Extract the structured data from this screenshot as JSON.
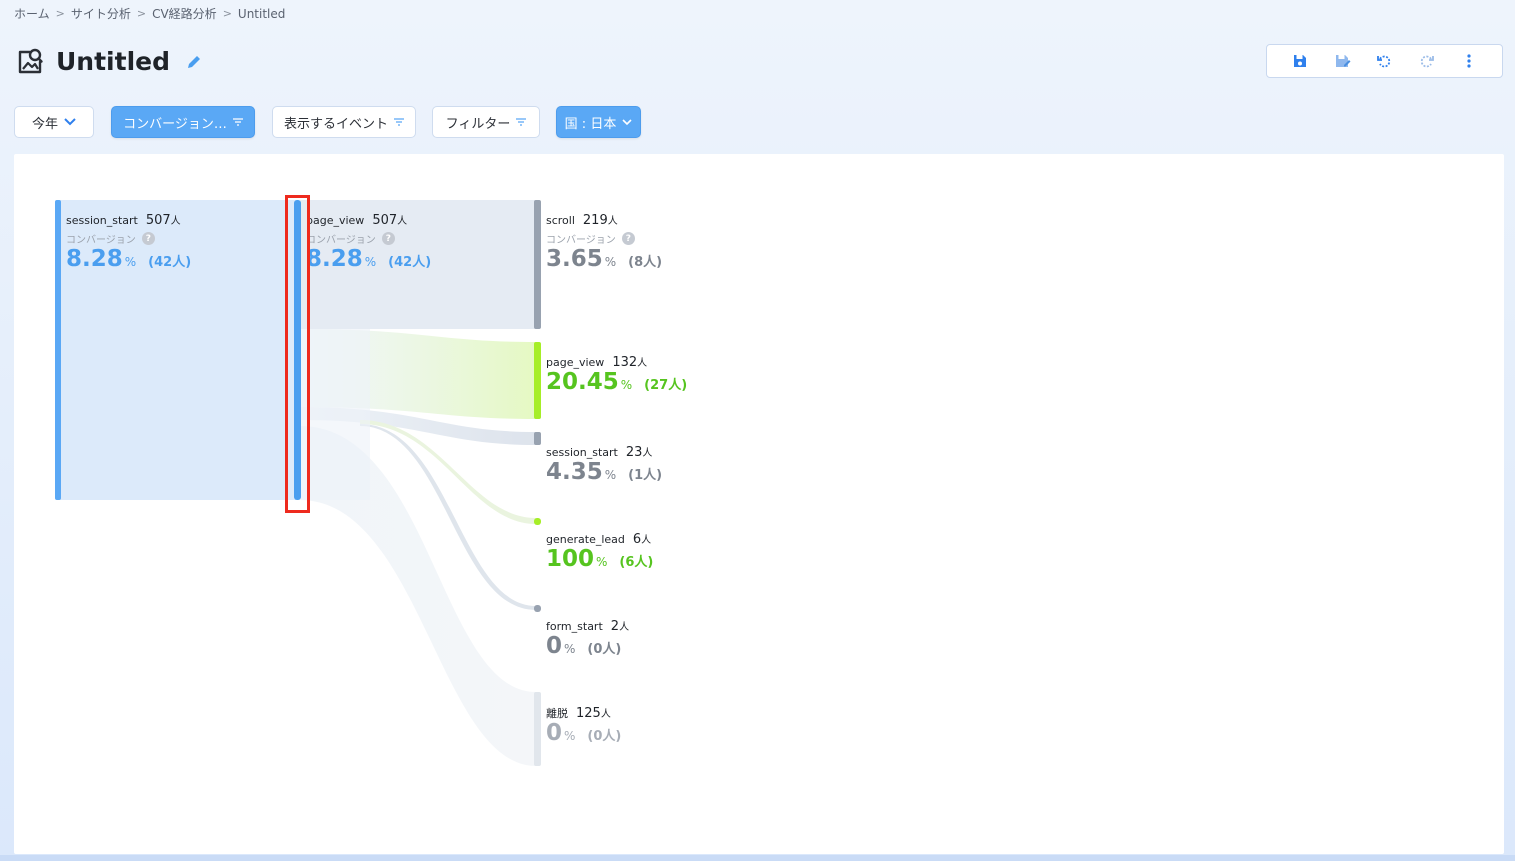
{
  "breadcrumb": [
    "ホーム",
    "サイト分析",
    "CV経路分析",
    "Untitled"
  ],
  "title": "Untitled",
  "filters": {
    "period": "今年",
    "conversion": "コンバージョン…",
    "events": "表示するイベント",
    "filter": "フィルター",
    "country": "国 : 日本"
  },
  "colors": {
    "accent_blue": "#5aa8f5",
    "green": "#56c41f",
    "lime": "#a6ee27",
    "gray": "#7d848e",
    "highlight_red": "#ee2a1e"
  },
  "nodes": {
    "level1": {
      "event": "session_start",
      "count": "507",
      "unit": "人",
      "sub": "コンバージョン",
      "pct": "8.28",
      "pct_unit": "%",
      "people": "(42人)"
    },
    "level2": {
      "event": "page_view",
      "count": "507",
      "unit": "人",
      "sub": "コンバージョン",
      "pct": "8.28",
      "pct_unit": "%",
      "people": "(42人)"
    },
    "targets": [
      {
        "event": "scroll",
        "count": "219",
        "unit": "人",
        "sub": "コンバージョン",
        "pct": "3.65",
        "pct_unit": "%",
        "people": "(8人)",
        "value": 219
      },
      {
        "event": "page_view",
        "count": "132",
        "unit": "人",
        "pct": "20.45",
        "pct_unit": "%",
        "people": "(27人)",
        "value": 132
      },
      {
        "event": "session_start",
        "count": "23",
        "unit": "人",
        "pct": "4.35",
        "pct_unit": "%",
        "people": "(1人)",
        "value": 23
      },
      {
        "event": "generate_lead",
        "count": "6",
        "unit": "人",
        "pct": "100",
        "pct_unit": "%",
        "people": "(6人)",
        "value": 6
      },
      {
        "event": "form_start",
        "count": "2",
        "unit": "人",
        "pct": "0",
        "pct_unit": "%",
        "people": "(0人)",
        "value": 2
      },
      {
        "event": "離脱",
        "count": "125",
        "unit": "人",
        "pct": "0",
        "pct_unit": "%",
        "people": "(0人)",
        "value": 125
      }
    ]
  },
  "help_mark": "?"
}
